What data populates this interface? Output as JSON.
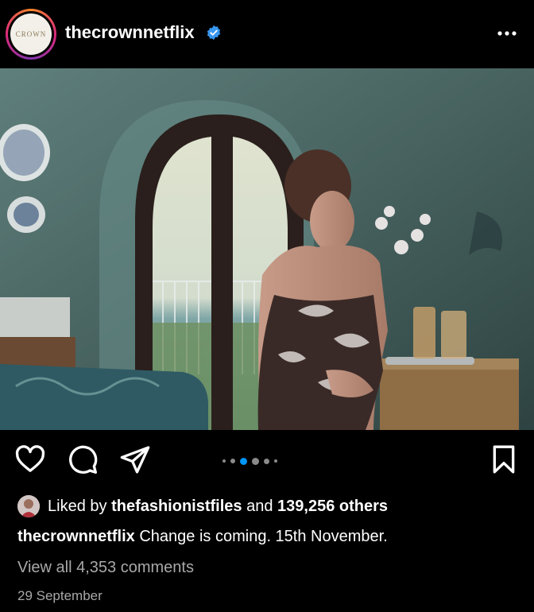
{
  "post": {
    "username": "thecrownnetflix",
    "avatar_text": "CROWN",
    "liked_by_prefix": "Liked by",
    "liked_by_user": "thefashionistfiles",
    "liked_by_and": "and",
    "liked_by_count": "139,256 others",
    "caption_user": "thecrownnetflix",
    "caption_text": "Change is coming. 15th November.",
    "view_comments": "View all 4,353 comments",
    "date": "29 September"
  },
  "icons": {
    "verified": "verified-badge-icon",
    "more": "more-options-icon",
    "like": "heart-icon",
    "comment": "comment-icon",
    "share": "send-icon",
    "save": "bookmark-icon"
  },
  "carousel": {
    "total": 6,
    "active_index": 2
  },
  "colors": {
    "verified": "#3897f0",
    "active_dot": "#0095f6",
    "secondary_text": "#a8a8a8"
  }
}
